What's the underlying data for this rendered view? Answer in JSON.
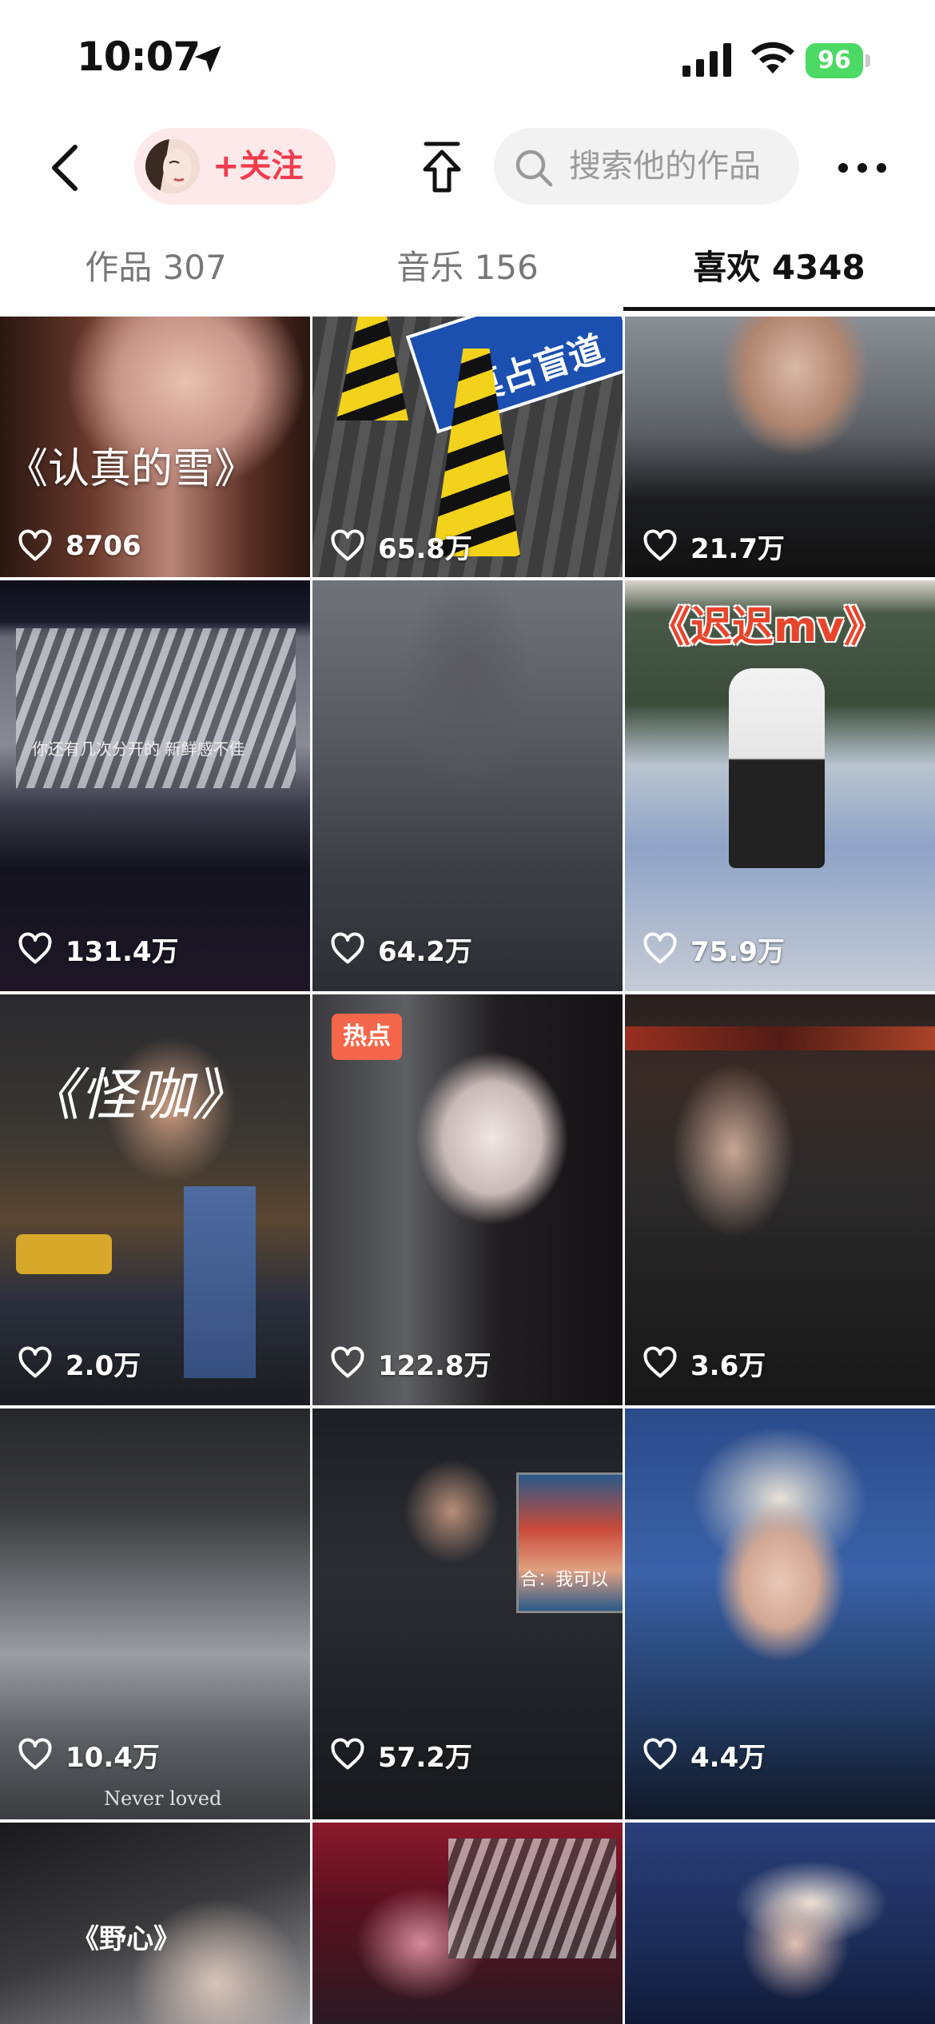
{
  "status_bar": {
    "time": "10:07",
    "battery": "96",
    "icons": [
      "location-arrow-icon",
      "signal-icon",
      "wifi-icon",
      "battery-icon"
    ]
  },
  "nav": {
    "follow_label": "+关注",
    "search_placeholder": "搜索他的作品",
    "icons": [
      "back-icon",
      "share-icon",
      "search-icon",
      "more-icon"
    ],
    "accent_color": "#f23b4e"
  },
  "tabs": [
    {
      "label": "作品 307",
      "active": false
    },
    {
      "label": "音乐 156",
      "active": false
    },
    {
      "label": "喜欢 4348",
      "active": true
    }
  ],
  "grid": [
    {
      "likes": "8706",
      "caption": "《认真的雪》",
      "badge": ""
    },
    {
      "likes": "65.8万",
      "caption": "莫占盲道",
      "badge": ""
    },
    {
      "likes": "21.7万",
      "caption": "",
      "badge": ""
    },
    {
      "likes": "131.4万",
      "caption": "你还有几次分开的 新鲜感不佳",
      "badge": ""
    },
    {
      "likes": "64.2万",
      "caption": "",
      "badge": ""
    },
    {
      "likes": "75.9万",
      "caption": "《迟迟mv》",
      "badge": ""
    },
    {
      "likes": "2.0万",
      "caption": "《怪咖》",
      "badge": ""
    },
    {
      "likes": "122.8万",
      "caption": "",
      "badge": "热点"
    },
    {
      "likes": "3.6万",
      "caption": "",
      "badge": ""
    },
    {
      "likes": "10.4万",
      "caption": "Never loved",
      "badge": ""
    },
    {
      "likes": "57.2万",
      "caption": "合：我可以",
      "badge": ""
    },
    {
      "likes": "4.4万",
      "caption": "",
      "badge": ""
    },
    {
      "likes": "",
      "caption": "《野心》",
      "badge": ""
    },
    {
      "likes": "",
      "caption": "",
      "badge": ""
    },
    {
      "likes": "",
      "caption": "",
      "badge": ""
    }
  ]
}
